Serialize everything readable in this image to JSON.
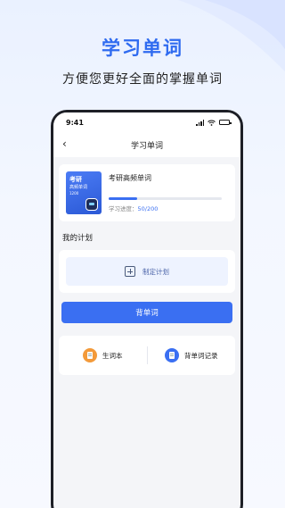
{
  "promo": {
    "headline": "学习单词",
    "subline": "方便您更好全面的掌握单词"
  },
  "status_bar": {
    "time": "9:41"
  },
  "nav": {
    "back_icon": "chevron-left-icon",
    "title": "学习单词"
  },
  "book_card": {
    "cover": {
      "title": "考研",
      "subtitle": "高频单词",
      "count": "1200"
    },
    "name": "考研高频单词",
    "progress_label": "学习进度：",
    "progress_value": "50/200",
    "progress_fraction": 0.25
  },
  "plan": {
    "section_title": "我的计划",
    "create_label": "制定计划"
  },
  "study_button": "背单词",
  "tools": {
    "vocab_label": "生词本",
    "record_label": "背单词记录"
  },
  "colors": {
    "accent": "#3a6ff2",
    "orange": "#f39a3a"
  }
}
